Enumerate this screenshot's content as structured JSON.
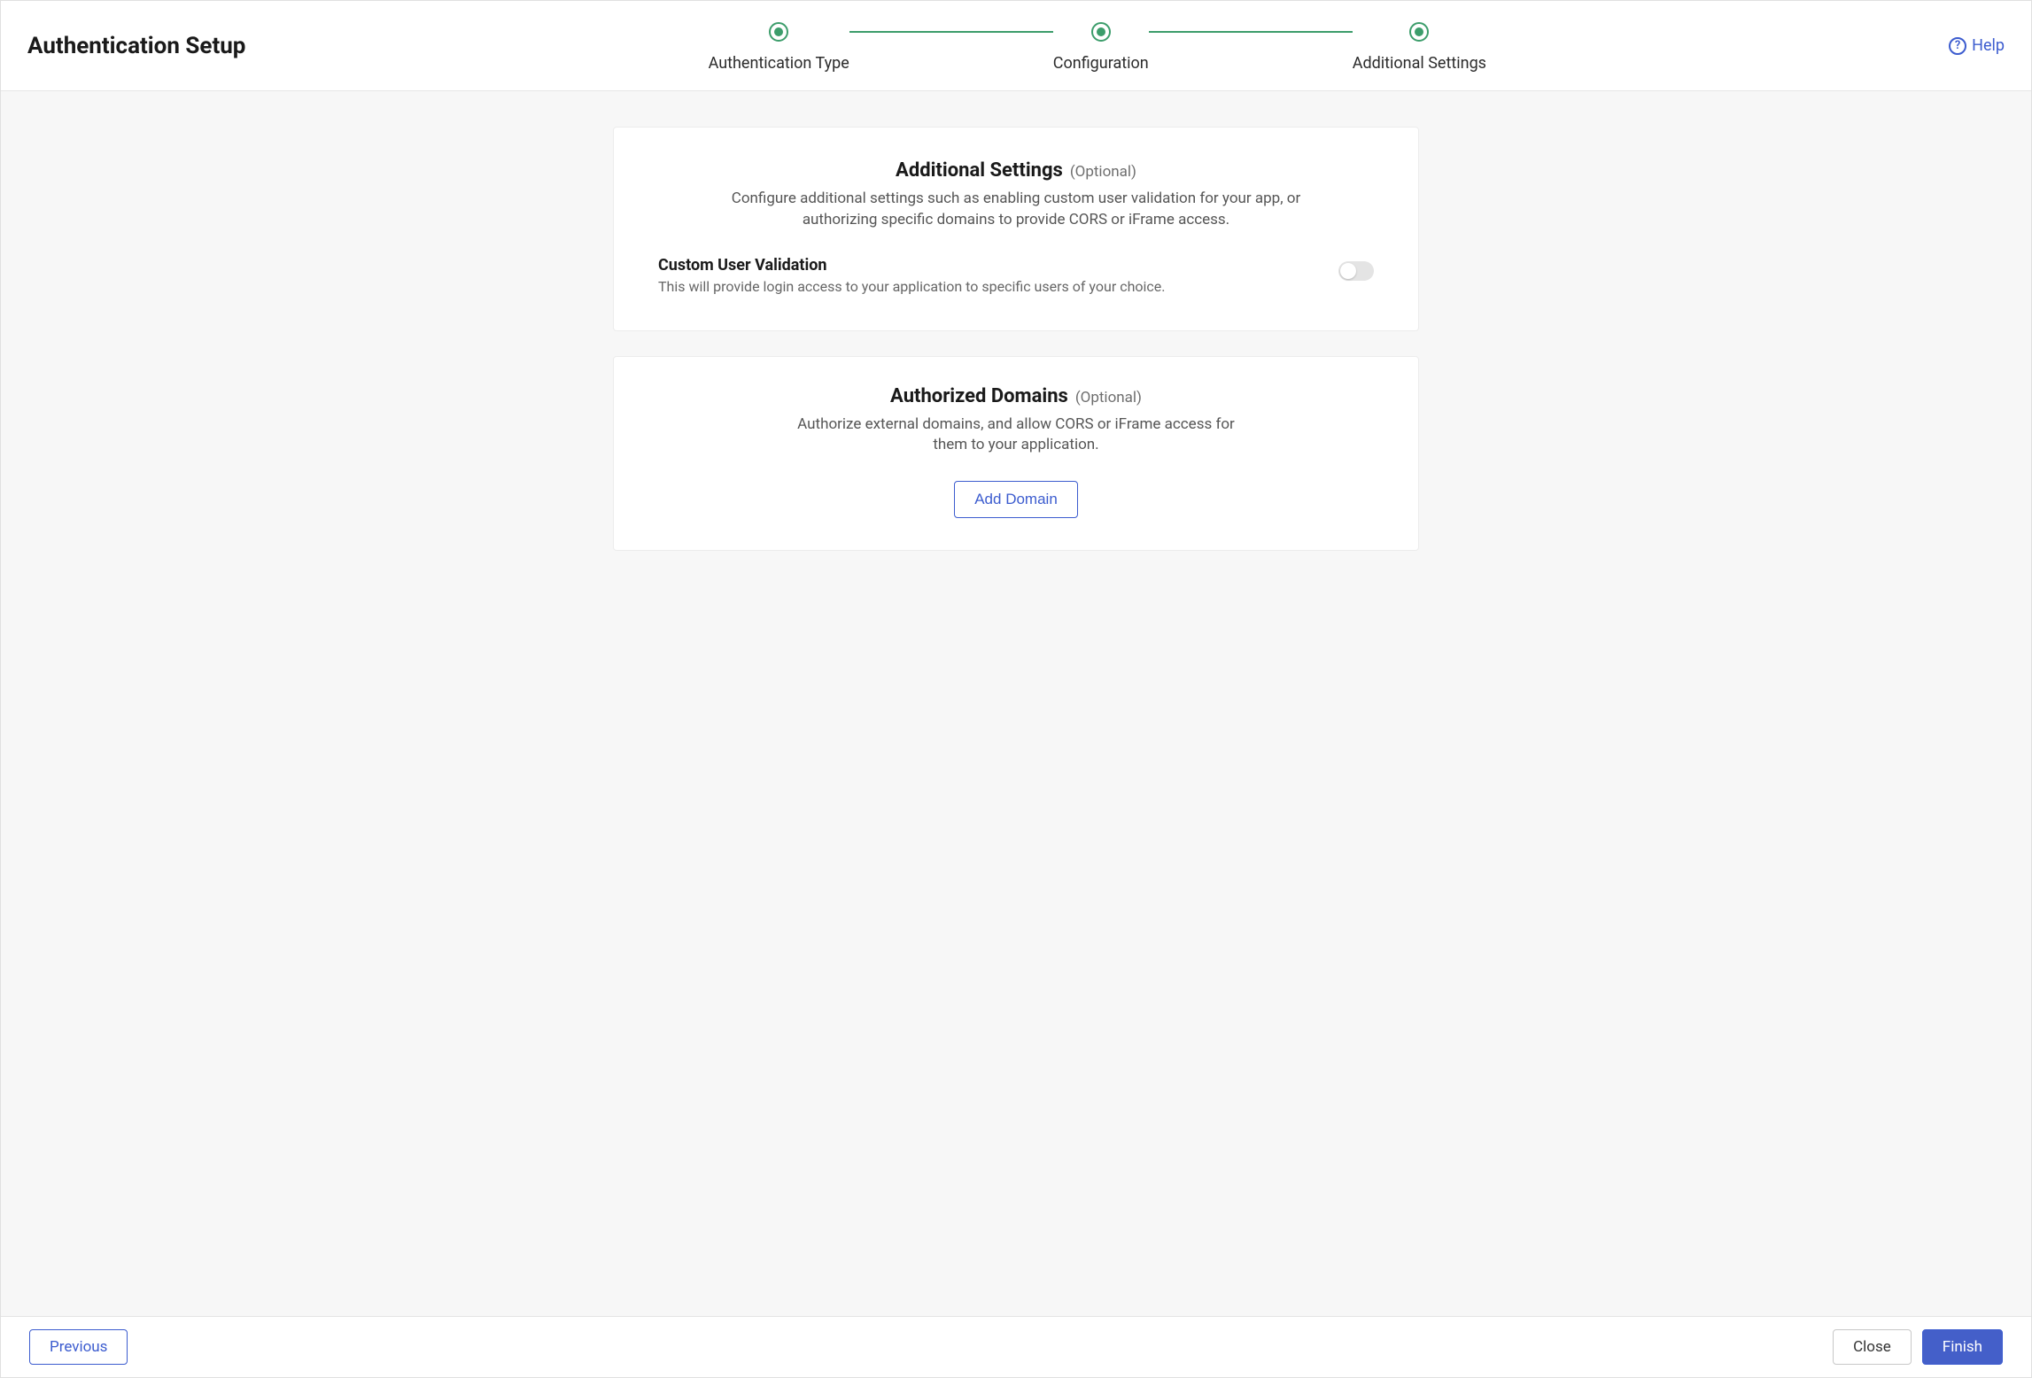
{
  "header": {
    "title": "Authentication Setup",
    "help_label": "Help"
  },
  "stepper": {
    "steps": [
      {
        "label": "Authentication Type"
      },
      {
        "label": "Configuration"
      },
      {
        "label": "Additional Settings"
      }
    ]
  },
  "cards": {
    "additional": {
      "title": "Additional Settings",
      "optional": "(Optional)",
      "description": "Configure additional settings such as enabling custom user validation for your app, or authorizing specific domains to provide CORS or iFrame access.",
      "customValidation": {
        "title": "Custom User Validation",
        "description": "This will provide login access to your application to specific users of your choice."
      }
    },
    "domains": {
      "title": "Authorized Domains",
      "optional": "(Optional)",
      "description": "Authorize external domains, and allow CORS or iFrame access for them to your application.",
      "addButton": "Add Domain"
    }
  },
  "footer": {
    "previous": "Previous",
    "close": "Close",
    "finish": "Finish"
  }
}
